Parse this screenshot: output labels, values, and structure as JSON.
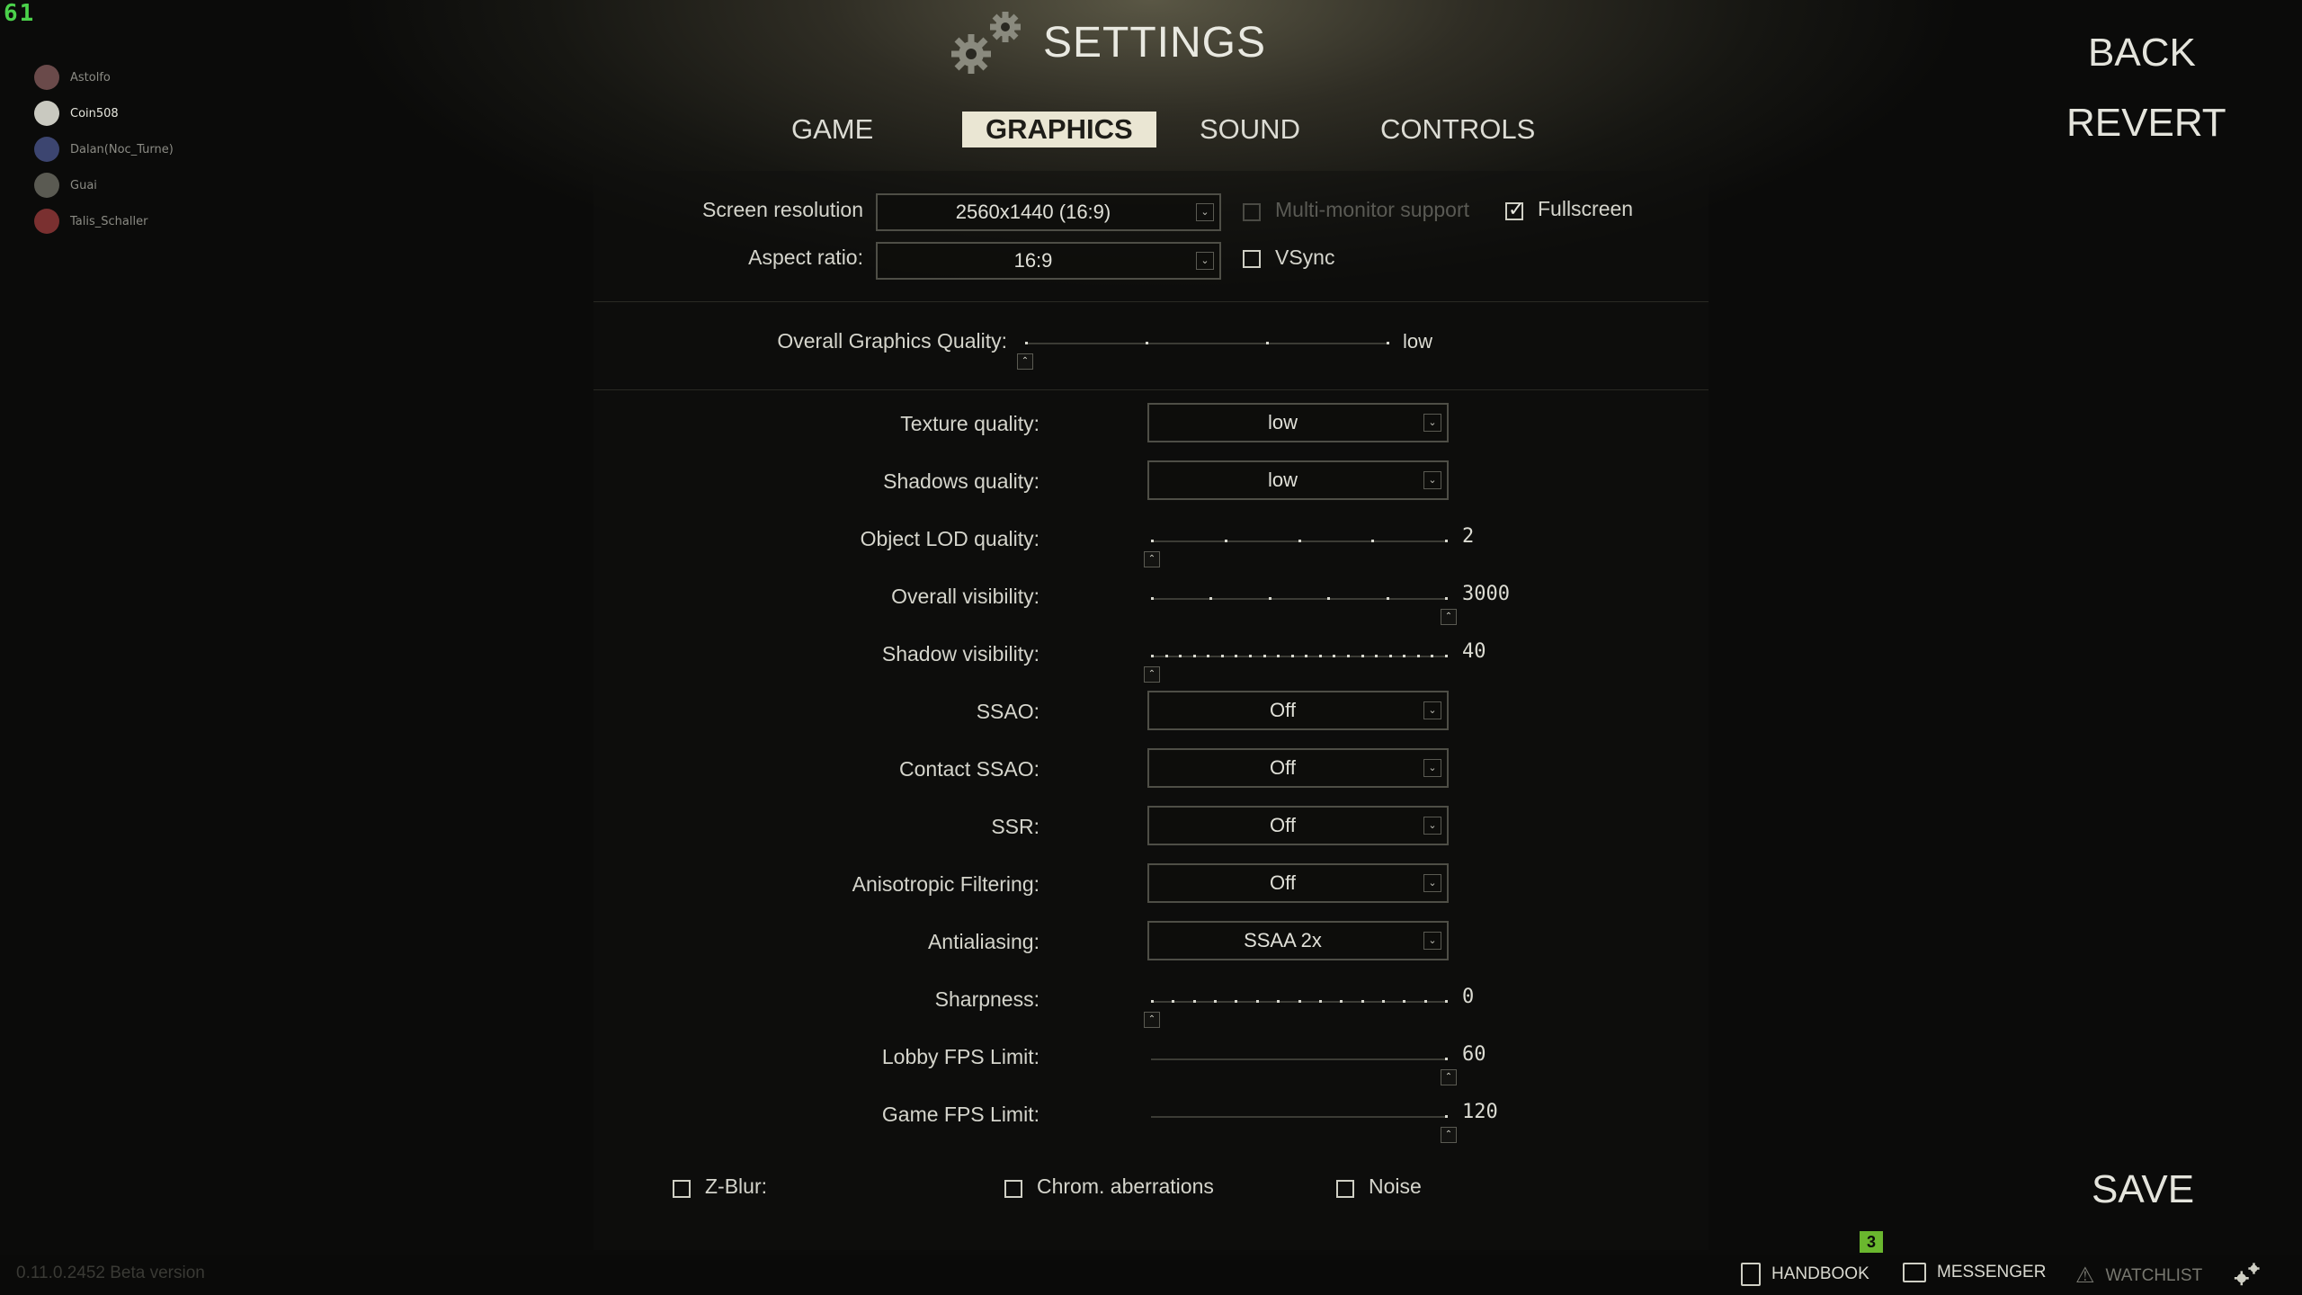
{
  "fps_counter": "61",
  "friends": [
    {
      "name": "Astolfo",
      "active": false,
      "avatar_color": "#6a4a4a"
    },
    {
      "name": "Coin508",
      "active": true,
      "avatar_color": "#c9c9c0"
    },
    {
      "name": "Dalan(Noc_Turne)",
      "active": false,
      "avatar_color": "#3c4570"
    },
    {
      "name": "Guai",
      "active": false,
      "avatar_color": "#5a5a52"
    },
    {
      "name": "Talis_Schaller",
      "active": false,
      "avatar_color": "#7a3030"
    }
  ],
  "header": {
    "title": "SETTINGS",
    "back_label": "BACK",
    "revert_label": "REVERT",
    "save_label": "SAVE"
  },
  "tabs": [
    {
      "label": "GAME",
      "active": false
    },
    {
      "label": "GRAPHICS",
      "active": true
    },
    {
      "label": "SOUND",
      "active": false
    },
    {
      "label": "CONTROLS",
      "active": false
    }
  ],
  "display": {
    "resolution_label": "Screen resolution",
    "resolution_value": "2560x1440 (16:9)",
    "aspect_label": "Aspect ratio:",
    "aspect_value": "16:9",
    "multimonitor_label": "Multi-monitor support",
    "multimonitor_checked": false,
    "fullscreen_label": "Fullscreen",
    "fullscreen_checked": true,
    "vsync_label": "VSync",
    "vsync_checked": false
  },
  "overall_quality": {
    "label": "Overall Graphics Quality:",
    "value": "low",
    "level": 0,
    "steps": 4
  },
  "settings": {
    "texture": {
      "label": "Texture quality:",
      "value": "low"
    },
    "shadows": {
      "label": "Shadows quality:",
      "value": "low"
    },
    "lod": {
      "label": "Object LOD quality:",
      "value": "2",
      "fraction": 0.0,
      "ticks": 5
    },
    "visibility": {
      "label": "Overall visibility:",
      "value": "3000",
      "fraction": 1.0,
      "ticks": 6
    },
    "shadow_visibility": {
      "label": "Shadow visibility:",
      "value": "40",
      "fraction": 0.0,
      "ticks": 22
    },
    "ssao": {
      "label": "SSAO:",
      "value": "Off"
    },
    "contact_ssao": {
      "label": "Contact SSAO:",
      "value": "Off"
    },
    "ssr": {
      "label": "SSR:",
      "value": "Off"
    },
    "aniso": {
      "label": "Anisotropic Filtering:",
      "value": "Off"
    },
    "aa": {
      "label": "Antialiasing:",
      "value": "SSAA 2x"
    },
    "sharpness": {
      "label": "Sharpness:",
      "value": "0",
      "fraction": 0.0,
      "ticks": 15
    },
    "lobby_fps": {
      "label": "Lobby FPS Limit:",
      "value": "60",
      "fraction": 1.0,
      "ticks": 1
    },
    "game_fps": {
      "label": "Game FPS Limit:",
      "value": "120",
      "fraction": 1.0,
      "ticks": 1
    }
  },
  "effects": {
    "zblur": {
      "label": "Z-Blur:",
      "checked": false
    },
    "chrom": {
      "label": "Chrom. aberrations",
      "checked": false
    },
    "noise": {
      "label": "Noise",
      "checked": false
    }
  },
  "bottom_bar": {
    "version": "0.11.0.2452 Beta version",
    "handbook_label": "HANDBOOK",
    "messenger_label": "MESSENGER",
    "watchlist_label": "WATCHLIST",
    "notification_count": "3"
  },
  "colors": {
    "accent_green": "#6ab72e",
    "tab_active_bg": "#eae6d3"
  }
}
